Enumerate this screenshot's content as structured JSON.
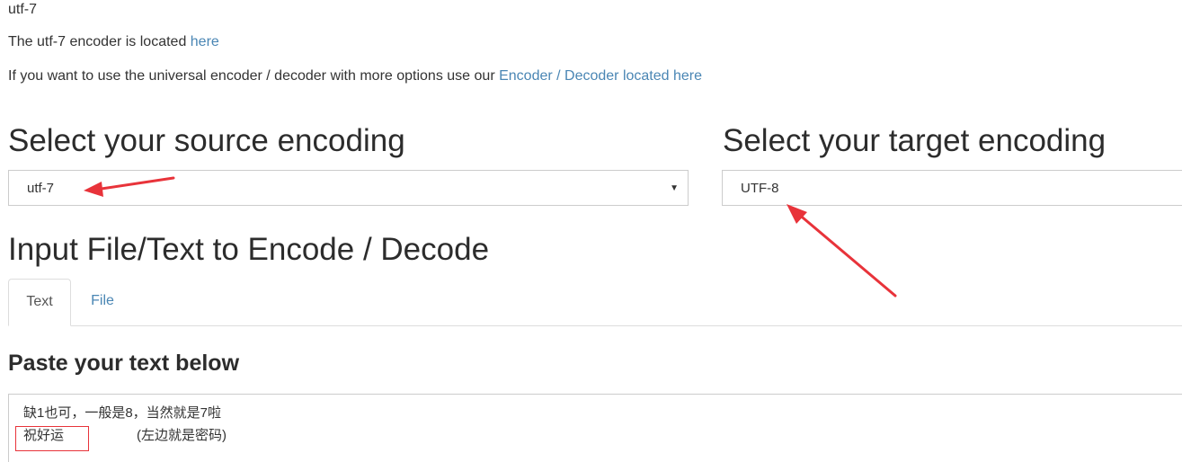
{
  "header": {
    "title": "utf-7",
    "encoder_text": "The utf-7 encoder is located ",
    "encoder_link": "here",
    "universal_text": "If you want to use the universal encoder / decoder with more options use our ",
    "universal_link": "Encoder / Decoder located here"
  },
  "source": {
    "heading": "Select your source encoding",
    "selected": "utf-7"
  },
  "target": {
    "heading": "Select your target encoding",
    "selected": "UTF-8"
  },
  "input": {
    "heading": "Input File/Text to Encode / Decode",
    "tabs": [
      {
        "label": "Text",
        "active": true
      },
      {
        "label": "File",
        "active": false
      }
    ]
  },
  "paste": {
    "heading": "Paste your text below",
    "line1": "缺1也可，一般是8，当然就是7啦",
    "line2_boxed": "祝好运",
    "line2_note": "(左边就是密码)"
  },
  "colors": {
    "link": "#4a86b4",
    "annotation": "#e8333a"
  },
  "icons": {
    "caret": "caret-down-icon",
    "arrows": "annotation-arrow-icon"
  }
}
